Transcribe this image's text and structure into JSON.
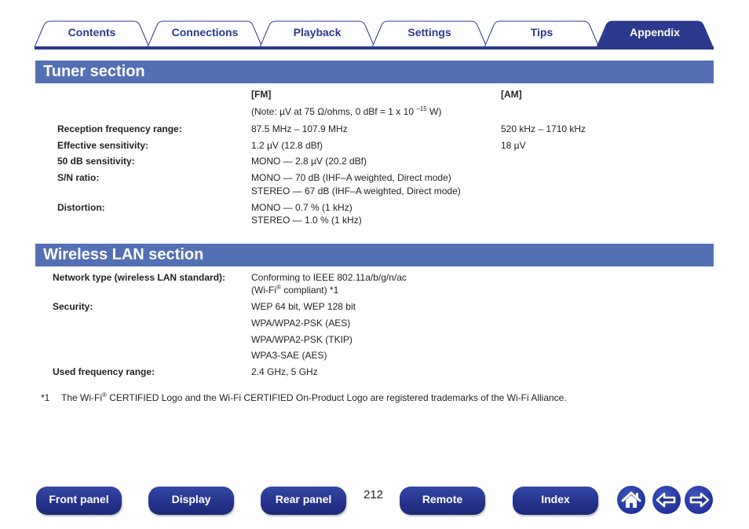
{
  "tabs": [
    {
      "label": "Contents",
      "active": false
    },
    {
      "label": "Connections",
      "active": false
    },
    {
      "label": "Playback",
      "active": false
    },
    {
      "label": "Settings",
      "active": false
    },
    {
      "label": "Tips",
      "active": false
    },
    {
      "label": "Appendix",
      "active": true
    }
  ],
  "tuner": {
    "title": "Tuner section",
    "fm_header": "[FM]",
    "am_header": "[AM]",
    "note_prefix": "(Note: µV at 75 Ω/ohms, 0 dBf = 1 x 10 ",
    "note_exp": "–15",
    "note_suffix": " W)",
    "rows": [
      {
        "label": "Reception frequency range:",
        "fm": [
          "87.5 MHz – 107.9 MHz"
        ],
        "am": "520 kHz – 1710 kHz"
      },
      {
        "label": "Effective sensitivity:",
        "fm": [
          "1.2 µV (12.8 dBf)"
        ],
        "am": "18 µV"
      },
      {
        "label": "50 dB sensitivity:",
        "fm": [
          "MONO — 2.8 µV (20.2 dBf)"
        ],
        "am": ""
      },
      {
        "label": "S/N ratio:",
        "fm": [
          "MONO — 70 dB (IHF–A weighted, Direct mode)",
          "STEREO — 67 dB (IHF–A weighted, Direct mode)"
        ],
        "am": ""
      },
      {
        "label": "Distortion:",
        "fm": [
          "MONO — 0.7 % (1 kHz)",
          "STEREO — 1.0 % (1 kHz)"
        ],
        "am": ""
      }
    ]
  },
  "wlan": {
    "title": "Wireless LAN section",
    "network_label": "Network type (wireless LAN standard):",
    "network_value": "Conforming to IEEE 802.11a/b/g/n/ac",
    "network_value2_prefix": "(Wi-Fi",
    "network_value2_reg": "®",
    "network_value2_suffix": " compliant) ",
    "network_value2_note": "*1",
    "security_label": "Security:",
    "security_values": [
      "WEP 64 bit, WEP 128 bit",
      "WPA/WPA2-PSK (AES)",
      "WPA/WPA2-PSK (TKIP)",
      "WPA3-SAE (AES)"
    ],
    "freq_label": "Used frequency range:",
    "freq_value": "2.4 GHz, 5 GHz"
  },
  "footnote": {
    "marker": "*1",
    "text_prefix": "The Wi-Fi",
    "reg": "®",
    "text_suffix": " CERTIFIED Logo and the Wi-Fi CERTIFIED On-Product Logo are registered trademarks of the Wi-Fi Alliance."
  },
  "page_number": "212",
  "bottom_nav": {
    "front_panel": "Front panel",
    "display": "Display",
    "rear_panel": "Rear panel",
    "remote": "Remote",
    "index": "Index",
    "home_icon": "home-icon",
    "back_icon": "arrow-left-icon",
    "forward_icon": "arrow-right-icon"
  },
  "colors": {
    "brand_dark": "#2b3a8c",
    "section_header": "#5470b5",
    "text": "#231f20"
  }
}
